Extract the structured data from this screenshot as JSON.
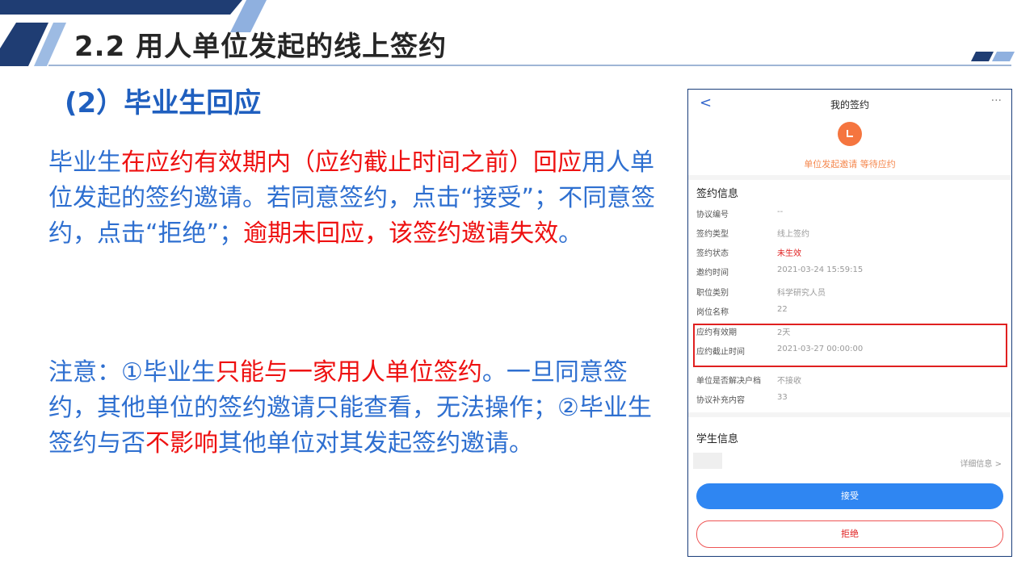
{
  "slide": {
    "title": "2.2 用人单位发起的线上签约",
    "subtitle": "(2）毕业生回应",
    "paragraph1": [
      {
        "text": "毕业生",
        "red": false
      },
      {
        "text": "在应约有效期内（应约截止时间之前）",
        "red": true
      },
      {
        "text": "回应",
        "red": true
      },
      {
        "text": "用人单位发起的签约邀请。",
        "red": false
      },
      {
        "text": "若同意签约，点击“接受”；不同意签约，点击“拒绝”；",
        "red": false
      },
      {
        "text": "逾期未回应，该签约邀请失效",
        "red": true
      },
      {
        "text": "。",
        "red": false
      }
    ],
    "paragraph2": [
      {
        "text": "注意：①毕业生",
        "red": false
      },
      {
        "text": "只能与一家用人单位签约",
        "red": true
      },
      {
        "text": "。一旦同意签约，其他单位的签约邀请只能查看，无法操作；",
        "red": false
      },
      {
        "text": "②毕业生签约与否",
        "red": false
      },
      {
        "text": "不影响",
        "red": true
      },
      {
        "text": "其他单位对其发起签约邀请。",
        "red": false
      }
    ]
  },
  "phone": {
    "back_icon": "chevron-left-icon",
    "back": "<",
    "title": "我的签约",
    "more": "···",
    "status_text": "单位发起邀请 等待应约",
    "section_sign": "签约信息",
    "fields": [
      {
        "label": "协议编号",
        "value": "--",
        "red": false
      },
      {
        "label": "签约类型",
        "value": "线上签约",
        "red": false
      },
      {
        "label": "签约状态",
        "value": "未生效",
        "red": true
      },
      {
        "label": "邀约时间",
        "value": "2021-03-24 15:59:15",
        "red": false
      },
      {
        "label": "职位类别",
        "value": "科学研究人员",
        "red": false
      },
      {
        "label": "岗位名称",
        "value": "22",
        "red": false
      },
      {
        "label": "应约有效期",
        "value": "2天",
        "red": false
      },
      {
        "label": "应约截止时间",
        "value": "2021-03-27 00:00:00",
        "red": false
      },
      {
        "label": "单位是否解决户档",
        "value": "不接收",
        "red": false
      },
      {
        "label": "协议补充内容",
        "value": "33",
        "red": false
      }
    ],
    "section_student": "学生信息",
    "detail_link": "详细信息 >",
    "accept": "接受",
    "reject": "拒绝"
  },
  "colors": {
    "title_blue": "#1f5fbf",
    "body_blue": "#2e6fd0",
    "highlight_red": "#ee1111",
    "accept_blue": "#2f86f2",
    "status_orange": "#f5753f"
  }
}
